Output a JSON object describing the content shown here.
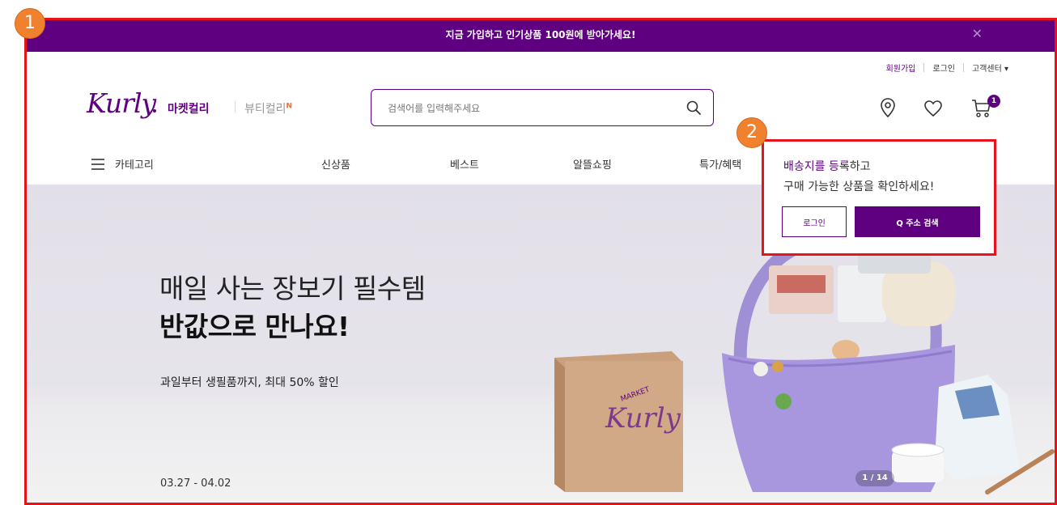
{
  "banner": {
    "text": "지금 가입하고 인기상품 100원에 받아가세요!",
    "close": "✕"
  },
  "util_links": {
    "signup": "회원가입",
    "login": "로그인",
    "support": "고객센터 ▾"
  },
  "logo": {
    "text": "Kurly"
  },
  "service_tabs": {
    "market": "마켓컬리",
    "beauty": "뷰티컬리",
    "beauty_badge": "N"
  },
  "search": {
    "placeholder": "검색어를 입력해주세요"
  },
  "cart": {
    "count": "1"
  },
  "nav": {
    "category": "카테고리",
    "new": "신상품",
    "best": "베스트",
    "saving": "알뜰쇼핑",
    "deals": "특가/혜택"
  },
  "hero": {
    "headline_1": "매일 사는 장보기 필수템",
    "headline_2": "반값으로 만나요!",
    "subtitle": "과일부터 생필품까지, 최대 50% 할인",
    "date_range": "03.27 - 04.02",
    "slide_indicator": "1 / 14",
    "box_label": "MARKET",
    "box_logo": "Kurly"
  },
  "delivery_popup": {
    "line1_highlight": "배송지를 등록",
    "line1_rest": "하고",
    "line2": "구매 가능한 상품을 확인하세요!",
    "login_button": "로그인",
    "address_button": "Q 주소 검색"
  },
  "callouts": {
    "one": "1",
    "two": "2"
  },
  "colors": {
    "brand": "#5f0080",
    "highlight_frame": "#e8121a",
    "callout": "#f0812f"
  },
  "icons": [
    "close-icon",
    "search-icon",
    "location-pin-icon",
    "heart-icon",
    "cart-icon",
    "hamburger-icon"
  ]
}
